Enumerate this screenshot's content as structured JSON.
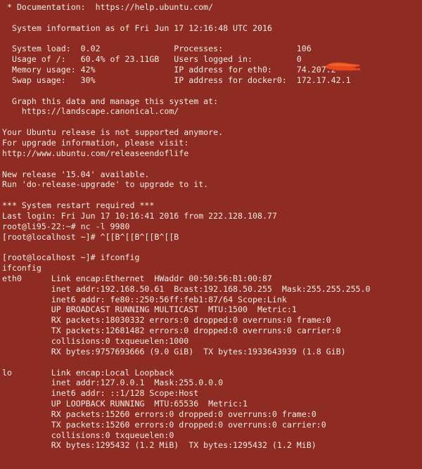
{
  "terminal": {
    "background_color": "#8e2b22",
    "foreground_color": "#f2ece4",
    "columns": 80,
    "redaction_color": "#ea4a1e"
  },
  "motd": {
    "documentation_line": " * Documentation:  https://help.ubuntu.com/",
    "system_info_header": "  System information as of Fri Jun 17 12:16:48 UTC 2016",
    "stats": [
      {
        "left_label": "System load:",
        "left_value": "0.02",
        "right_label": "Processes:",
        "right_value": "106"
      },
      {
        "left_label": "Usage of /:",
        "left_value": "60.4% of 23.11GB",
        "right_label": "Users logged in:",
        "right_value": "0"
      },
      {
        "left_label": "Memory usage:",
        "left_value": "42%",
        "right_label": "IP address for eth0:",
        "right_value": "74.207.2"
      },
      {
        "left_label": "Swap usage:",
        "left_value": "30%",
        "right_label": "IP address for docker0:",
        "right_value": "172.17.42.1"
      }
    ],
    "stats_lines": [
      "  System load:  0.02               Processes:               106",
      "  Usage of /:   60.4% of 23.11GB   Users logged in:         0",
      "  Memory usage: 42%                IP address for eth0:     74.207.2",
      "  Swap usage:   30%                IP address for docker0:  172.17.42.1"
    ],
    "landscape_prompt": "  Graph this data and manage this system at:",
    "landscape_url": "    https://landscape.canonical.com/",
    "eol_notice": [
      "Your Ubuntu release is not supported anymore.",
      "For upgrade information, please visit:",
      "http://www.ubuntu.com/releaseendoflife"
    ],
    "new_release": [
      "New release '15.04' available.",
      "Run 'do-release-upgrade' to upgrade to it."
    ],
    "restart_required": "*** System restart required ***",
    "last_login": "Last login: Fri Jun 17 10:16:41 2016 from 222.128.108.77"
  },
  "session": {
    "prompt_remote": "root@li95-22:~#",
    "command_nc": "nc -l 9980",
    "prompt_local": "[root@localhost ~]#",
    "escape_sequence": "^[[B^[[B^[[B^[[B",
    "command_ifconfig": "ifconfig",
    "echo_ifconfig": "ifconfig"
  },
  "ifconfig": {
    "interfaces": [
      {
        "name": "eth0",
        "lines": [
          "Link encap:Ethernet  HWaddr 00:50:56:B1:00:87",
          "inet addr:192.168.50.61  Bcast:192.168.50.255  Mask:255.255.255.0",
          "inet6 addr: fe80::250:56ff:feb1:87/64 Scope:Link",
          "UP BROADCAST RUNNING MULTICAST  MTU:1500  Metric:1",
          "RX packets:18030332 errors:0 dropped:0 overruns:0 frame:0",
          "TX packets:12681482 errors:0 dropped:0 overruns:0 carrier:0",
          "collisions:0 txqueuelen:1000",
          "RX bytes:9757693666 (9.0 GiB)  TX bytes:1933643939 (1.8 GiB)"
        ]
      },
      {
        "name": "lo",
        "lines": [
          "Link encap:Local Loopback",
          "inet addr:127.0.0.1  Mask:255.0.0.0",
          "inet6 addr: ::1/128 Scope:Host",
          "UP LOOPBACK RUNNING  MTU:65536  Metric:1",
          "RX packets:15260 errors:0 dropped:0 overruns:0 frame:0",
          "TX packets:15260 errors:0 dropped:0 overruns:0 carrier:0",
          "collisions:0 txqueuelen:0",
          "RX bytes:1295432 (1.2 MiB)  TX bytes:1295432 (1.2 MiB)"
        ]
      }
    ]
  },
  "screen_lines": [
    " * Documentation:  https://help.ubuntu.com/",
    "",
    "  System information as of Fri Jun 17 12:16:48 UTC 2016",
    "",
    "  System load:  0.02               Processes:               106",
    "  Usage of /:   60.4% of 23.11GB   Users logged in:         0",
    "  Memory usage: 42%                IP address for eth0:     74.207.2",
    "  Swap usage:   30%                IP address for docker0:  172.17.42.1",
    "",
    "  Graph this data and manage this system at:",
    "    https://landscape.canonical.com/",
    "",
    "Your Ubuntu release is not supported anymore.",
    "For upgrade information, please visit:",
    "http://www.ubuntu.com/releaseendoflife",
    "",
    "New release '15.04' available.",
    "Run 'do-release-upgrade' to upgrade to it.",
    "",
    "*** System restart required ***",
    "Last login: Fri Jun 17 10:16:41 2016 from 222.128.108.77",
    "root@li95-22:~# nc -l 9980",
    "[root@localhost ~]# ^[[B^[[B^[[B^[[B",
    "",
    "[root@localhost ~]# ifconfig",
    "ifconfig",
    "eth0      Link encap:Ethernet  HWaddr 00:50:56:B1:00:87",
    "          inet addr:192.168.50.61  Bcast:192.168.50.255  Mask:255.255.255.0",
    "          inet6 addr: fe80::250:56ff:feb1:87/64 Scope:Link",
    "          UP BROADCAST RUNNING MULTICAST  MTU:1500  Metric:1",
    "          RX packets:18030332 errors:0 dropped:0 overruns:0 frame:0",
    "          TX packets:12681482 errors:0 dropped:0 overruns:0 carrier:0",
    "          collisions:0 txqueuelen:1000",
    "          RX bytes:9757693666 (9.0 GiB)  TX bytes:1933643939 (1.8 GiB)",
    "",
    "lo        Link encap:Local Loopback",
    "          inet addr:127.0.0.1  Mask:255.0.0.0",
    "          inet6 addr: ::1/128 Scope:Host",
    "          UP LOOPBACK RUNNING  MTU:65536  Metric:1",
    "          RX packets:15260 errors:0 dropped:0 overruns:0 frame:0",
    "          TX packets:15260 errors:0 dropped:0 overruns:0 carrier:0",
    "          collisions:0 txqueuelen:0",
    "          RX bytes:1295432 (1.2 MiB)  TX bytes:1295432 (1.2 MiB)"
  ]
}
